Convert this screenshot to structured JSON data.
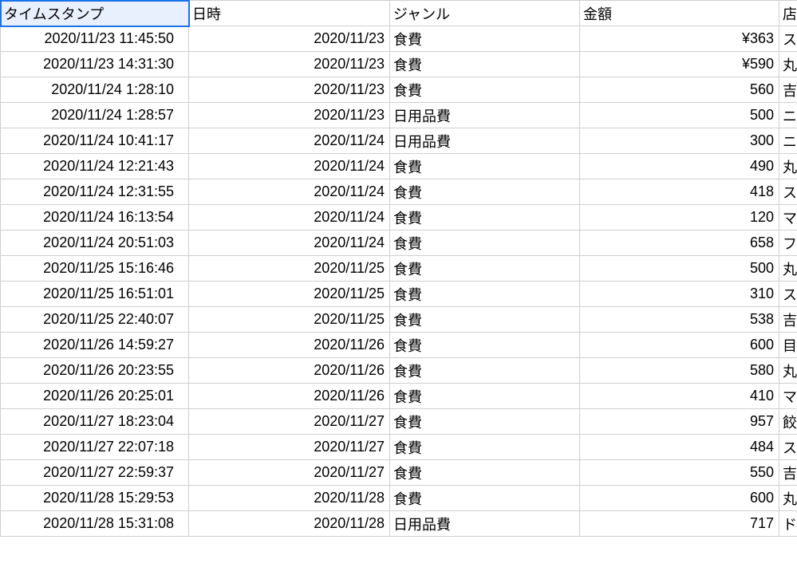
{
  "headers": {
    "timestamp": "タイムスタンプ",
    "datetime": "日時",
    "genre": "ジャンル",
    "amount": "金額",
    "store": "店"
  },
  "rows": [
    {
      "timestamp": "2020/11/23 11:45:50",
      "datetime": "2020/11/23",
      "genre": "食費",
      "amount": "¥363",
      "store": "ス"
    },
    {
      "timestamp": "2020/11/23 14:31:30",
      "datetime": "2020/11/23",
      "genre": "食費",
      "amount": "¥590",
      "store": "丸"
    },
    {
      "timestamp": "2020/11/24 1:28:10",
      "datetime": "2020/11/23",
      "genre": "食費",
      "amount": "560",
      "store": "吉"
    },
    {
      "timestamp": "2020/11/24 1:28:57",
      "datetime": "2020/11/23",
      "genre": "日用品費",
      "amount": "500",
      "store": "ニ"
    },
    {
      "timestamp": "2020/11/24 10:41:17",
      "datetime": "2020/11/24",
      "genre": "日用品費",
      "amount": "300",
      "store": "ニ"
    },
    {
      "timestamp": "2020/11/24 12:21:43",
      "datetime": "2020/11/24",
      "genre": "食費",
      "amount": "490",
      "store": "丸"
    },
    {
      "timestamp": "2020/11/24 12:31:55",
      "datetime": "2020/11/24",
      "genre": "食費",
      "amount": "418",
      "store": "ス"
    },
    {
      "timestamp": "2020/11/24 16:13:54",
      "datetime": "2020/11/24",
      "genre": "食費",
      "amount": "120",
      "store": "マ"
    },
    {
      "timestamp": "2020/11/24 20:51:03",
      "datetime": "2020/11/24",
      "genre": "食費",
      "amount": "658",
      "store": "フ"
    },
    {
      "timestamp": "2020/11/25 15:16:46",
      "datetime": "2020/11/25",
      "genre": "食費",
      "amount": "500",
      "store": "丸"
    },
    {
      "timestamp": "2020/11/25 16:51:01",
      "datetime": "2020/11/25",
      "genre": "食費",
      "amount": "310",
      "store": "ス"
    },
    {
      "timestamp": "2020/11/25 22:40:07",
      "datetime": "2020/11/25",
      "genre": "食費",
      "amount": "538",
      "store": "吉"
    },
    {
      "timestamp": "2020/11/26 14:59:27",
      "datetime": "2020/11/26",
      "genre": "食費",
      "amount": "600",
      "store": "目"
    },
    {
      "timestamp": "2020/11/26 20:23:55",
      "datetime": "2020/11/26",
      "genre": "食費",
      "amount": "580",
      "store": "丸"
    },
    {
      "timestamp": "2020/11/26 20:25:01",
      "datetime": "2020/11/26",
      "genre": "食費",
      "amount": "410",
      "store": "マ"
    },
    {
      "timestamp": "2020/11/27 18:23:04",
      "datetime": "2020/11/27",
      "genre": "食費",
      "amount": "957",
      "store": "餃"
    },
    {
      "timestamp": "2020/11/27 22:07:18",
      "datetime": "2020/11/27",
      "genre": "食費",
      "amount": "484",
      "store": "ス"
    },
    {
      "timestamp": "2020/11/27 22:59:37",
      "datetime": "2020/11/27",
      "genre": "食費",
      "amount": "550",
      "store": "吉"
    },
    {
      "timestamp": "2020/11/28 15:29:53",
      "datetime": "2020/11/28",
      "genre": "食費",
      "amount": "600",
      "store": "丸"
    },
    {
      "timestamp": "2020/11/28 15:31:08",
      "datetime": "2020/11/28",
      "genre": "日用品費",
      "amount": "717",
      "store": "ド"
    }
  ]
}
